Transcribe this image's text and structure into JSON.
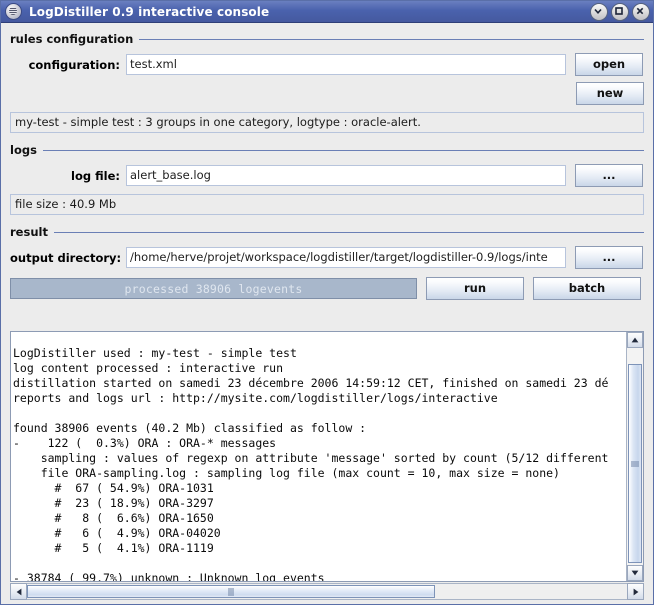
{
  "window": {
    "title": "LogDistiller 0.9 interactive console",
    "app_icon": "app-disc-icon",
    "buttons": {
      "minimize": "minimize-icon",
      "maximize": "maximize-icon",
      "close": "close-icon"
    }
  },
  "rules_configuration": {
    "group_label": "rules configuration",
    "configuration_label": "configuration:",
    "configuration_value": "test.xml",
    "open_label": "open",
    "new_label": "new",
    "summary": "my-test - simple test : 3 groups in one category, logtype : oracle-alert."
  },
  "logs": {
    "group_label": "logs",
    "log_file_label": "log file:",
    "log_file_value": "alert_base.log",
    "browse_label": "...",
    "file_size": "file size : 40.9 Mb"
  },
  "result": {
    "group_label": "result",
    "output_directory_label": "output directory:",
    "output_directory_value": "/home/herve/projet/workspace/logdistiller/target/logdistiller-0.9/logs/inte",
    "browse_label": "...",
    "progress_text": "processed 38906 logevents",
    "progress_percent": 100,
    "run_label": "run",
    "batch_label": "batch"
  },
  "console": {
    "text": "LogDistiller used : my-test - simple test\nlog content processed : interactive run\ndistillation started on samedi 23 décembre 2006 14:59:12 CET, finished on samedi 23 dé\nreports and logs url : http://mysite.com/logdistiller/logs/interactive\n\nfound 38906 events (40.2 Mb) classified as follow :\n-    122 (  0.3%) ORA : ORA-* messages\n    sampling : values of regexp on attribute 'message' sorted by count (5/12 different\n    file ORA-sampling.log : sampling log file (max count = 10, max size = none)\n      #  67 ( 54.9%) ORA-1031\n      #  23 ( 18.9%) ORA-3297\n      #   8 (  6.6%) ORA-1650\n      #   6 (  4.9%) ORA-04020\n      #   5 (  4.1%) ORA-1119\n\n- 38784 ( 99.7%) unknown : Unknown log events"
  },
  "colors": {
    "titlebar_start": "#6a7fc0",
    "titlebar_end": "#45599f",
    "group_rule": "#6a7fb5",
    "progress_fill": "#a8b7cb",
    "field_border": "#b7c4dc",
    "panel_bg": "#ececec"
  }
}
